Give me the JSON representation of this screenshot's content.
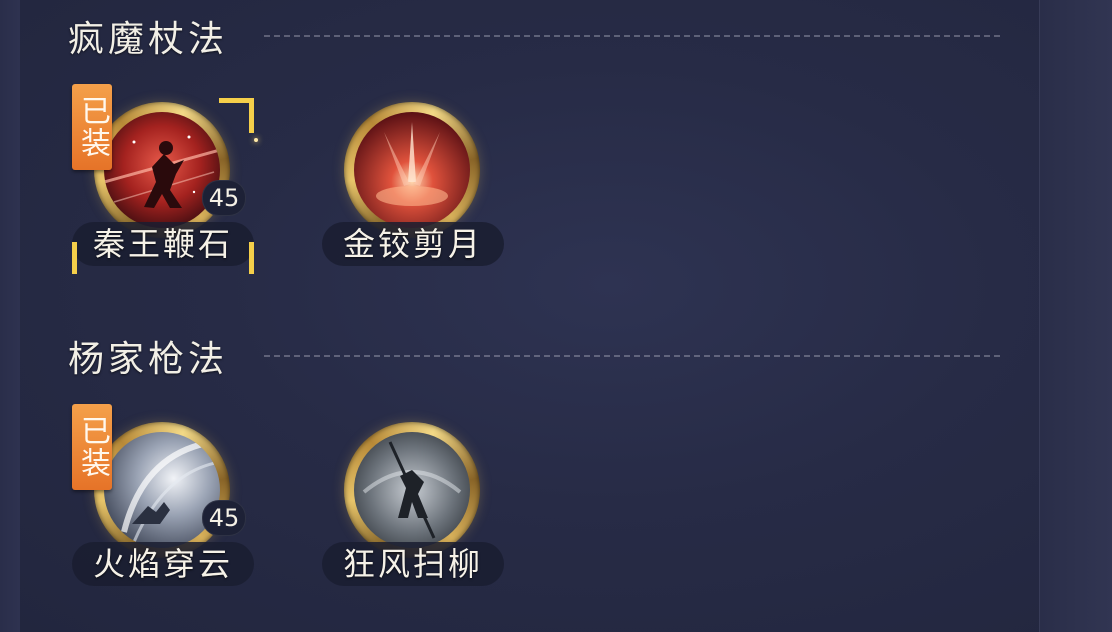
{
  "theme": {
    "background": "#262a44",
    "title_color": "#f2efe6",
    "equipped_tag_color": "#e67328",
    "ring_gold": "#e8c56a",
    "selection_gold": "#f5cf4a"
  },
  "sections": [
    {
      "title": "疯魔杖法",
      "skills": [
        {
          "name": "秦王鞭石",
          "equipped": true,
          "equipped_label": "已装",
          "level": "45",
          "selected": true,
          "art": "red-staff-warrior"
        },
        {
          "name": "金铰剪月",
          "equipped": false,
          "equipped_label": "",
          "level": "",
          "selected": false,
          "art": "red-burst"
        }
      ]
    },
    {
      "title": "杨家枪法",
      "skills": [
        {
          "name": "火焰穿云",
          "equipped": true,
          "equipped_label": "已装",
          "level": "45",
          "selected": false,
          "art": "white-wind-spear"
        },
        {
          "name": "狂风扫柳",
          "equipped": false,
          "equipped_label": "",
          "level": "",
          "selected": false,
          "art": "grey-spear-sweep"
        }
      ]
    }
  ]
}
